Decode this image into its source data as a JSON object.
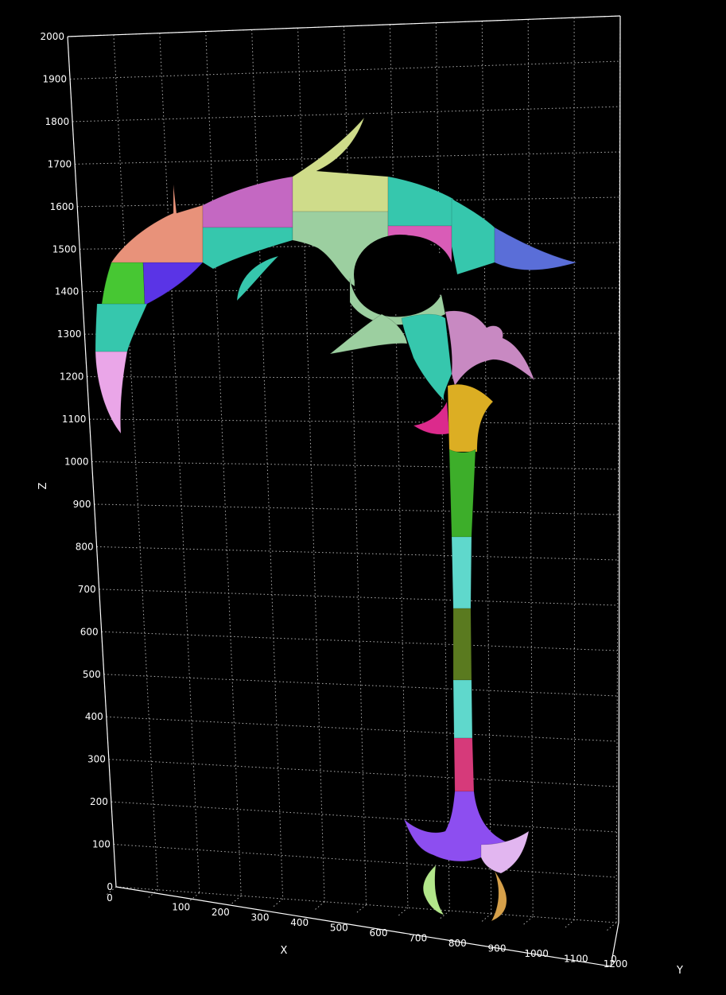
{
  "axes": {
    "x_title": "X",
    "y_title": "Y",
    "z_title": "Z"
  },
  "z_ticks": [
    "0",
    "100",
    "200",
    "300",
    "400",
    "500",
    "600",
    "700",
    "800",
    "900",
    "1000",
    "1100",
    "1200",
    "1300",
    "1400",
    "1500",
    "1600",
    "1700",
    "1800",
    "1900",
    "2000"
  ],
  "x_ticks": [
    "0",
    "100",
    "200",
    "300",
    "400",
    "500",
    "600",
    "700",
    "800",
    "900",
    "1000",
    "1100",
    "1200"
  ],
  "y_ticks": [
    "0"
  ],
  "scene": {
    "object": "scythe-mesh",
    "segment_colors": {
      "salmon": "#e8927a",
      "magenta_light": "#c468c2",
      "yellow_green": "#cfdc8a",
      "teal": "#36c7ad",
      "sage": "#9ccfa0",
      "pink": "#d95cb7",
      "blue": "#5a6ed8",
      "green": "#47c733",
      "violet": "#5a34e6",
      "pink_light": "#eaa6e8",
      "light_green": "#b2e68a",
      "mauve": "#c889c2",
      "gold": "#dcae23",
      "hot_pink": "#dc2a8c",
      "shaft_green": "#3dae2a",
      "cyan": "#5fd8cc",
      "olive": "#5a7a1f",
      "crimson": "#d63a7a",
      "purple": "#8d4ef0",
      "lilac": "#e2b6f0",
      "khaki": "#d6a04a"
    }
  }
}
